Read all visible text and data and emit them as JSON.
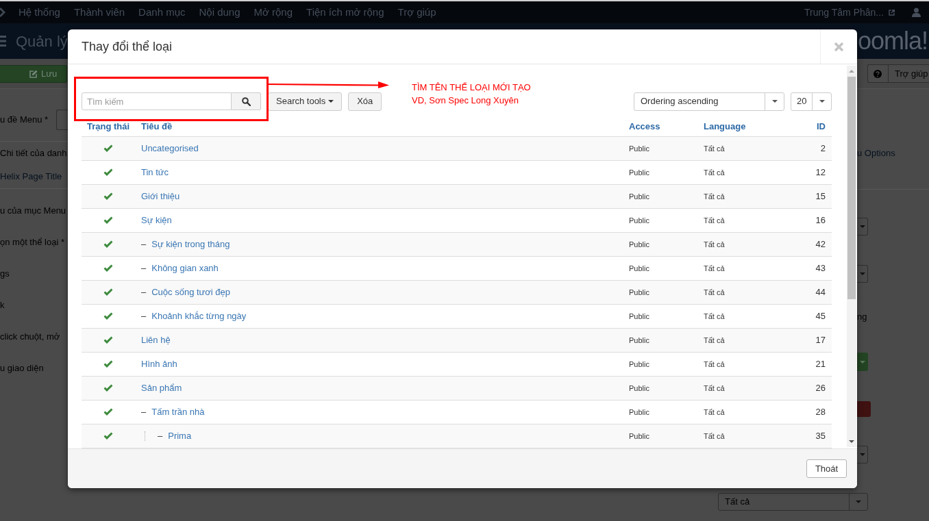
{
  "top_nav": {
    "menu": [
      "Hệ thống",
      "Thành viên",
      "Danh mục",
      "Nội dung",
      "Mở rộng",
      "Tiện ích mở rộng",
      "Trợ giúp"
    ],
    "site_link": "Trung Tâm Phân..."
  },
  "header": {
    "title": "Quản lý",
    "logo_text": "oomla!"
  },
  "toolbar": {
    "save_button": "Lưu",
    "help_button": "Trợ giúp"
  },
  "form_left": {
    "field_label": "u đề Menu *",
    "tabs": [
      {
        "label": "Chi tiết của danh",
        "selected": true
      },
      {
        "label": "Helix Page Title",
        "selected": false
      }
    ],
    "labels": [
      "u của mục Menu",
      "ọn một thể loại *",
      "gs",
      "k",
      "click chuột, mở",
      "u giao diện"
    ]
  },
  "form_right": {
    "items": [
      {
        "kind": "link",
        "text": "u Options"
      },
      {
        "kind": "select"
      },
      {
        "kind": "select"
      },
      {
        "kind": "text",
        "text": "ng"
      },
      {
        "kind": "success_button"
      },
      {
        "kind": "danger_button"
      },
      {
        "kind": "select"
      }
    ],
    "bottom_select": "Tất cả"
  },
  "modal": {
    "title": "Thay đổi thể loại",
    "search": {
      "placeholder": "Tìm kiếm"
    },
    "search_tools": "Search tools",
    "clear": "Xóa",
    "ordering": "Ordering ascending",
    "limit": "20",
    "columns": [
      "Trạng thái",
      "Tiêu đề",
      "Access",
      "Language",
      "ID"
    ],
    "rows": [
      {
        "title": "Uncategorised",
        "published": true,
        "access": "Public",
        "language": "Tất cả",
        "id": "2"
      },
      {
        "title": "Tin tức",
        "published": true,
        "access": "Public",
        "language": "Tất cả",
        "id": "12"
      },
      {
        "title": "Giới thiệu",
        "published": true,
        "access": "Public",
        "language": "Tất cả",
        "id": "15"
      },
      {
        "title": "Sự kiện",
        "published": true,
        "access": "Public",
        "language": "Tất cả",
        "id": "16",
        "children": [
          {
            "prefix": "–",
            "title": "Sự kiện trong tháng",
            "published": true,
            "access": "Public",
            "language": "Tất cả",
            "id": "42"
          },
          {
            "prefix": "–",
            "title": "Không gian xanh",
            "published": true,
            "access": "Public",
            "language": "Tất cả",
            "id": "43"
          },
          {
            "prefix": "–",
            "title": "Cuộc sống tươi đẹp",
            "published": true,
            "access": "Public",
            "language": "Tất cả",
            "id": "44"
          },
          {
            "prefix": "–",
            "title": "Khoảnh khắc từng ngày",
            "published": true,
            "access": "Public",
            "language": "Tất cả",
            "id": "45"
          }
        ]
      },
      {
        "title": "Liên hệ",
        "published": true,
        "access": "Public",
        "language": "Tất cả",
        "id": "17"
      },
      {
        "title": "Hình ảnh",
        "published": true,
        "access": "Public",
        "language": "Tất cả",
        "id": "21"
      },
      {
        "title": "Sản phẩm",
        "published": true,
        "access": "Public",
        "language": "Tất cả",
        "id": "26",
        "children": [
          {
            "prefix": "–",
            "title": "Tấm trần nhà",
            "published": true,
            "access": "Public",
            "language": "Tất cả",
            "id": "28",
            "children": [
              {
                "prefix": "–",
                "title": "Prima",
                "published": true,
                "access": "Public",
                "language": "Tất cả",
                "id": "35"
              }
            ]
          }
        ]
      }
    ],
    "close_button": "Thoát"
  },
  "annotation": {
    "lines": [
      "TÌM TÊN THỂ LOẠI MỚI TẠO",
      "VD, Sơn Spec Long Xuyên"
    ]
  }
}
